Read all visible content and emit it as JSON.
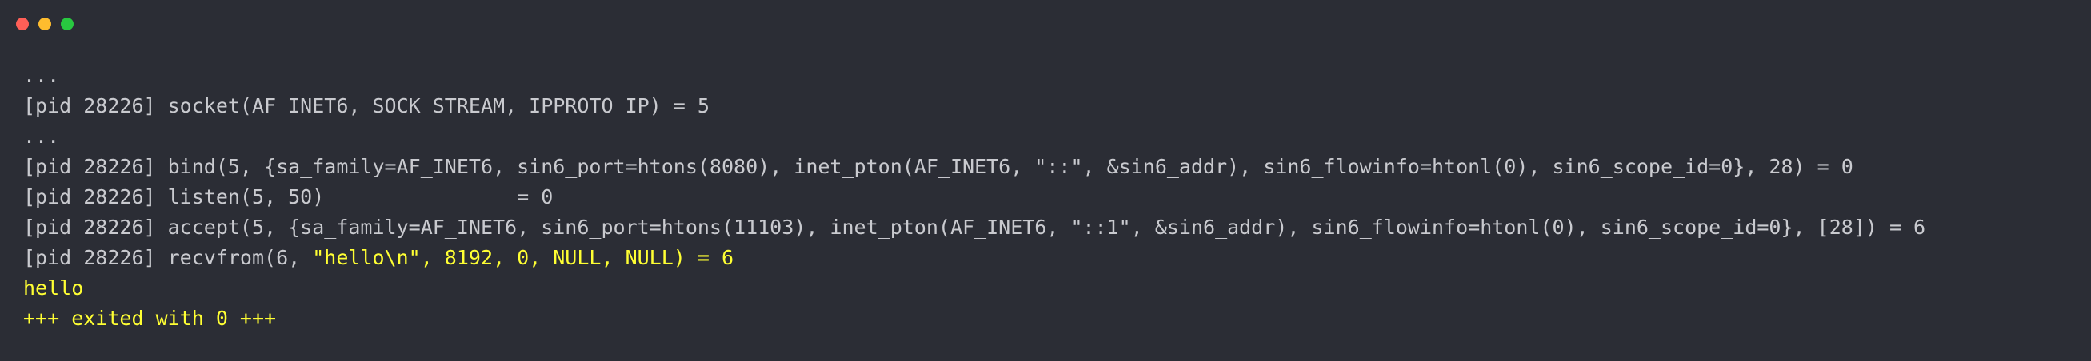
{
  "window": {
    "controls": {
      "close_color": "#ff5f57",
      "minimize_color": "#febc2e",
      "maximize_color": "#28c840"
    }
  },
  "colors": {
    "background": "#2b2d35",
    "text": "#c9cacf",
    "highlight": "#ffff33"
  },
  "terminal": {
    "lines": [
      {
        "segments": [
          {
            "text": "...",
            "style": "plain"
          }
        ]
      },
      {
        "segments": [
          {
            "text": "[pid 28226] socket(AF_INET6, SOCK_STREAM, IPPROTO_IP) = 5",
            "style": "plain"
          }
        ]
      },
      {
        "segments": [
          {
            "text": "...",
            "style": "plain"
          }
        ]
      },
      {
        "segments": [
          {
            "text": "[pid 28226] bind(5, {sa_family=AF_INET6, sin6_port=htons(8080), inet_pton(AF_INET6, \"::\", &sin6_addr), sin6_flowinfo=htonl(0), sin6_scope_id=0}, 28) = 0",
            "style": "plain"
          }
        ]
      },
      {
        "segments": [
          {
            "text": "[pid 28226] listen(5, 50)                = 0",
            "style": "plain"
          }
        ]
      },
      {
        "segments": [
          {
            "text": "[pid 28226] accept(5, {sa_family=AF_INET6, sin6_port=htons(11103), inet_pton(AF_INET6, \"::1\", &sin6_addr), sin6_flowinfo=htonl(0), sin6_scope_id=0}, [28]) = 6",
            "style": "plain"
          }
        ]
      },
      {
        "segments": [
          {
            "text": "[pid 28226] recvfrom(6, ",
            "style": "plain"
          },
          {
            "text": "\"hello\\n\", 8192, 0, NULL, NULL) = 6",
            "style": "hl"
          }
        ]
      },
      {
        "segments": [
          {
            "text": "hello",
            "style": "hl"
          }
        ]
      },
      {
        "segments": [
          {
            "text": "+++ exited with 0 +++",
            "style": "hl"
          }
        ]
      }
    ]
  }
}
